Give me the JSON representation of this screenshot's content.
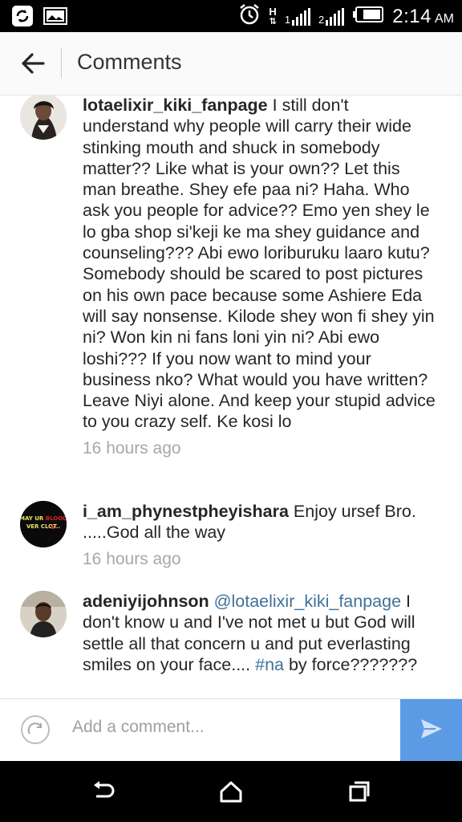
{
  "status_bar": {
    "time": "2:14",
    "ampm": "AM",
    "network_glyph": "H",
    "sim1_label": "1",
    "sim2_label": "2"
  },
  "header": {
    "title": "Comments",
    "back_icon": "back-arrow-icon"
  },
  "comments": [
    {
      "username": "lotaelixir_kiki_fanpage",
      "text": "I still don't understand why people will carry their wide stinking mouth and shuck in somebody matter?? Like what is your own?? Let this man breathe. Shey efe paa ni? Haha. Who ask you people for advice?? Emo yen shey le lo gba shop si'keji ke ma shey guidance and counseling??? Abi ewo loriburuku laaro kutu? Somebody should be scared to post pictures on his own pace because some Ashiere Eda will say nonsense. Kilode shey won fi shey yin ni? Won kin ni fans loni yin ni? Abi ewo loshi??? If you now want to mind your business nko? What would you have written? Leave Niyi alone. And keep your stupid advice to you crazy self. Ke kosi lo",
      "time": "16 hours ago"
    },
    {
      "username": "i_am_phynestpheyishara",
      "text": "Enjoy ursef Bro. .....God all the way",
      "time": "16 hours ago",
      "avatar_text": "MAY UR BLOOD NEVER CLOT..."
    },
    {
      "username": "adeniyijohnson",
      "mention": "@lotaelixir_kiki_fanpage",
      "text_a": "I don't know u and I've not met u but God will settle all that concern u and put everlasting smiles on your face....",
      "hashtag": "#na",
      "text_b": "by force???????"
    }
  ],
  "composer": {
    "placeholder": "Add a comment...",
    "camera_icon": "camera-icon",
    "send_icon": "send-icon"
  },
  "navbar": {
    "icons": [
      "back-nav-icon",
      "home-icon",
      "recents-icon"
    ]
  },
  "colors": {
    "link": "#3f729b",
    "send_button": "#5b9be6",
    "meta_text": "#a8a8a8"
  }
}
